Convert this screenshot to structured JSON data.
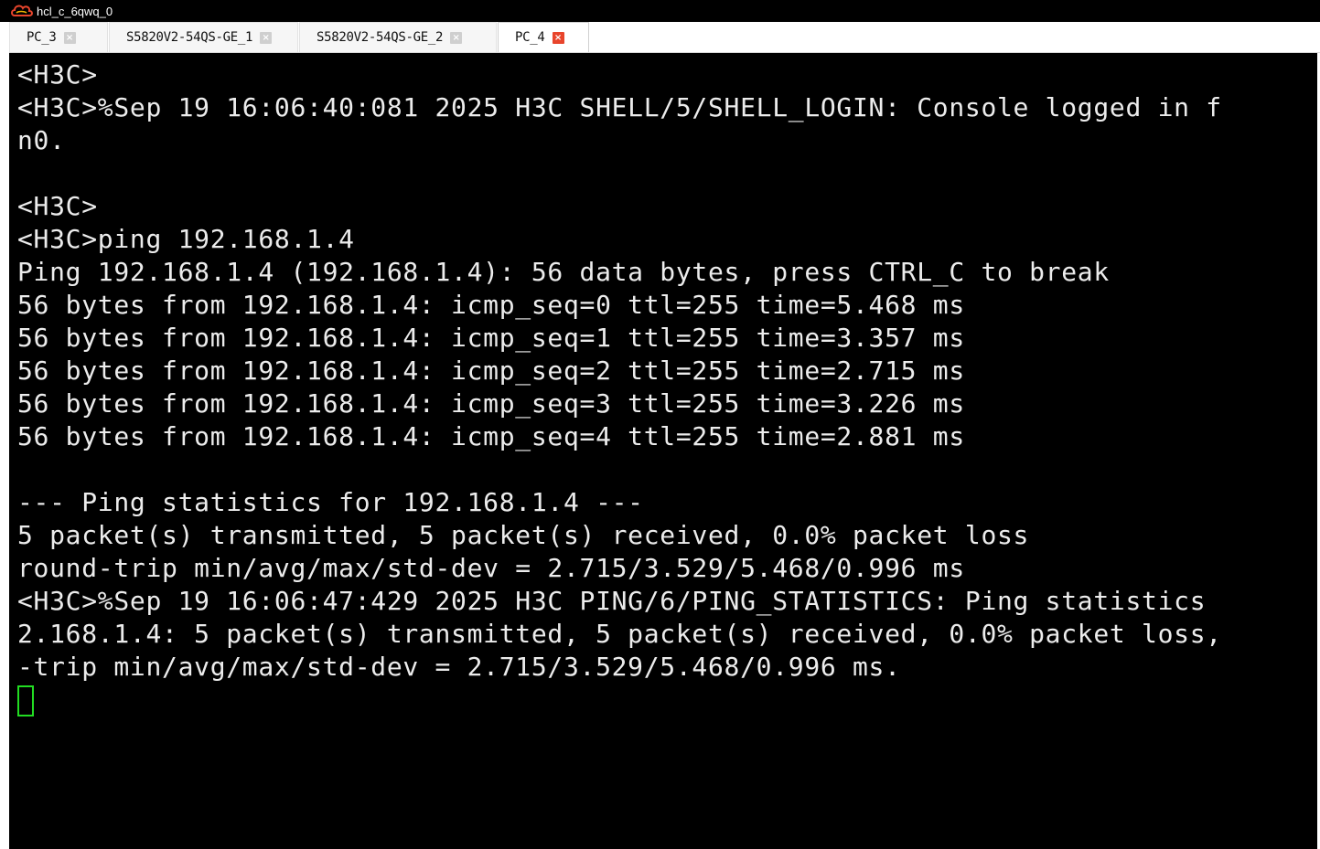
{
  "window": {
    "title": "hcl_c_6qwq_0",
    "icon": "cloud-logo-icon"
  },
  "tabs": [
    {
      "label": "PC_3",
      "active": false
    },
    {
      "label": "S5820V2-54QS-GE_1",
      "active": false
    },
    {
      "label": "S5820V2-54QS-GE_2",
      "active": false
    },
    {
      "label": "PC_4",
      "active": true
    }
  ],
  "terminal": {
    "lines": [
      "<H3C>",
      "<H3C>%Sep 19 16:06:40:081 2025 H3C SHELL/5/SHELL_LOGIN: Console logged in f",
      "n0.",
      "",
      "<H3C>",
      "<H3C>ping 192.168.1.4",
      "Ping 192.168.1.4 (192.168.1.4): 56 data bytes, press CTRL_C to break",
      "56 bytes from 192.168.1.4: icmp_seq=0 ttl=255 time=5.468 ms",
      "56 bytes from 192.168.1.4: icmp_seq=1 ttl=255 time=3.357 ms",
      "56 bytes from 192.168.1.4: icmp_seq=2 ttl=255 time=2.715 ms",
      "56 bytes from 192.168.1.4: icmp_seq=3 ttl=255 time=3.226 ms",
      "56 bytes from 192.168.1.4: icmp_seq=4 ttl=255 time=2.881 ms",
      "",
      "--- Ping statistics for 192.168.1.4 ---",
      "5 packet(s) transmitted, 5 packet(s) received, 0.0% packet loss",
      "round-trip min/avg/max/std-dev = 2.715/3.529/5.468/0.996 ms",
      "<H3C>%Sep 19 16:06:47:429 2025 H3C PING/6/PING_STATISTICS: Ping statistics",
      "2.168.1.4: 5 packet(s) transmitted, 5 packet(s) received, 0.0% packet loss,",
      "-trip min/avg/max/std-dev = 2.715/3.529/5.468/0.996 ms."
    ],
    "cursor_color": "#22dd22",
    "text_color": "#ececec",
    "background": "#000000"
  },
  "colors": {
    "active_tab_close": "#e8452c",
    "inactive_tab_close": "#cfcfcf"
  }
}
